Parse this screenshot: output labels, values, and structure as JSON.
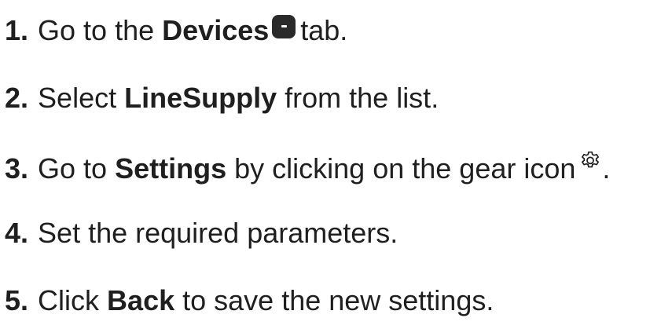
{
  "steps": [
    {
      "number": "1.",
      "before": "Go to the",
      "bold": "Devices",
      "after": "tab.",
      "icon": "devices-tab-icon"
    },
    {
      "number": "2.",
      "before": "Select",
      "bold": "LineSupply",
      "after": "from the list."
    },
    {
      "number": "3.",
      "before": "Go to",
      "bold": "Settings",
      "after": "by clicking on the gear icon",
      "icon": "gear-icon",
      "tail": "."
    },
    {
      "number": "4.",
      "text": "Set the required parameters."
    },
    {
      "number": "5.",
      "before": "Click",
      "bold": "Back",
      "after": "to save the new settings."
    }
  ],
  "colors": {
    "text": "#1f1f1f",
    "icon_fill": "#2a2a2a"
  }
}
